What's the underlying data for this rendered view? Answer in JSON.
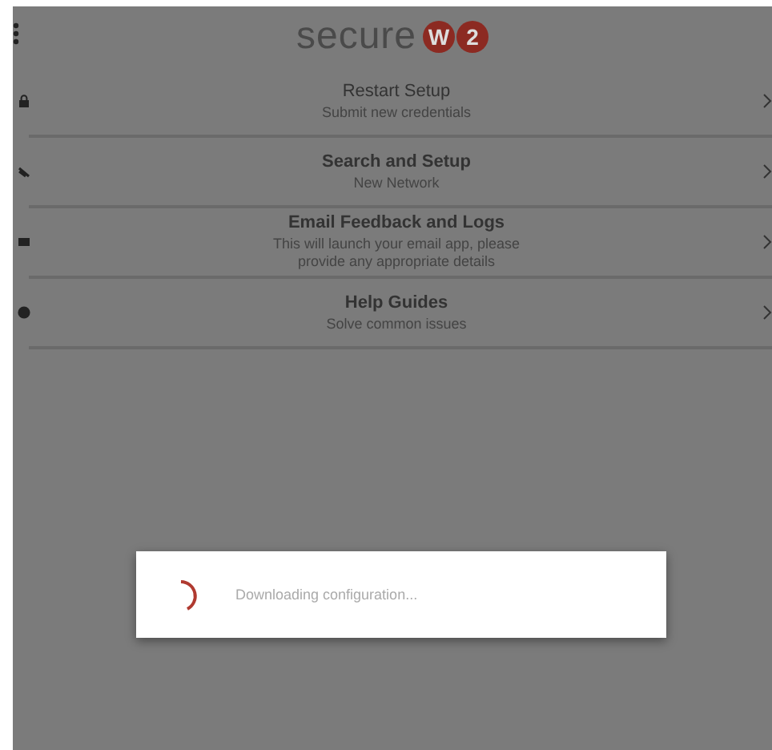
{
  "header": {
    "logo": {
      "word": "secure",
      "letters": [
        "W",
        "2"
      ]
    }
  },
  "menu": [
    {
      "title": "Restart Setup",
      "subtitle": "Submit new credentials",
      "bold": false
    },
    {
      "title": "Search and Setup",
      "subtitle": "New Network",
      "bold": true
    },
    {
      "title": "Email Feedback and Logs",
      "subtitle": "This will launch your email app, please provide any appropriate details",
      "bold": true
    },
    {
      "title": "Help Guides",
      "subtitle": "Solve common issues",
      "bold": true
    }
  ],
  "dialog": {
    "message": "Downloading configuration..."
  }
}
